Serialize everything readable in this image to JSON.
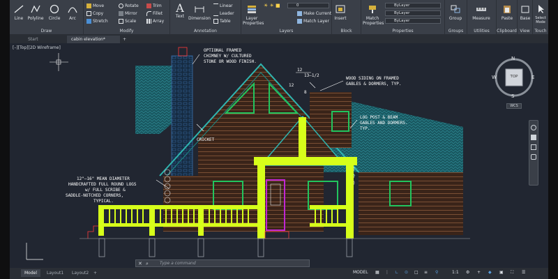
{
  "ribbon": {
    "draw": {
      "label": "Draw",
      "line": "Line",
      "polyline": "Polyline",
      "circle": "Circle",
      "arc": "Arc"
    },
    "modify": {
      "label": "Modify",
      "move": "Move",
      "rotate": "Rotate",
      "trim": "Trim",
      "copy": "Copy",
      "mirror": "Mirror",
      "fillet": "Fillet",
      "stretch": "Stretch",
      "scale": "Scale",
      "array": "Array"
    },
    "annotation": {
      "label": "Annotation",
      "text": "Text",
      "dimension": "Dimension",
      "linear": "Linear",
      "leader": "Leader",
      "table": "Table"
    },
    "layers": {
      "label": "Layers",
      "layer_properties": "Layer Properties",
      "current_layer": "0",
      "make_current": "Make Current",
      "match_layer": "Match Layer"
    },
    "block": {
      "label": "Block",
      "insert": "Insert"
    },
    "properties": {
      "label": "Properties",
      "match_properties": "Match Properties",
      "bylayer": "ByLayer"
    },
    "groups": {
      "label": "Groups",
      "group": "Group"
    },
    "utilities": {
      "label": "Utilities",
      "measure": "Measure"
    },
    "clipboard": {
      "label": "Clipboard",
      "paste": "Paste"
    },
    "view": {
      "label": "View",
      "base": "Base"
    },
    "touch": {
      "label": "Touch",
      "select_mode": "Select Mode"
    }
  },
  "file_tabs": [
    "Start",
    "cabin elevation*"
  ],
  "viewport_label": "[–][Top][2D Wireframe]",
  "viewcube": {
    "n": "N",
    "s": "S",
    "e": "E",
    "w": "W",
    "top": "TOP",
    "wcs": "WCS"
  },
  "annotations": {
    "chimney": [
      "OPTIONAL FRAMED",
      "CHIMNEY W/ CULTURED",
      "STONE OR WOOD FINISH."
    ],
    "siding": [
      "WOOD SIDING ON FRAMED",
      "GABLES & DORMERS, TYP."
    ],
    "log_post": [
      "LOG POST & BEAM",
      "GABLES AND DORMERS.",
      "TYP."
    ],
    "cricket": "CRICKET",
    "logs": [
      "12\"–16\" MEAN DIAMETER",
      "HANDCRAFTED FULL ROUND LOGS",
      "w/ FULL SCRIBE &",
      "SADDLE-NOTCHED CORNERS,",
      "TYPICAL."
    ],
    "pitch_12": "12",
    "pitch_13": "13–1/2",
    "pitch_12b": "12",
    "pitch_8": "8"
  },
  "command_placeholder": "Type a command",
  "layout_tabs": [
    "Model",
    "Layout1",
    "Layout2"
  ],
  "status": {
    "model": "MODEL",
    "scale": "1:1"
  },
  "colors": {
    "accent_green": "#d7ff1a",
    "roof_teal": "#1f7f86",
    "wall": "#5a3a2a",
    "window_green": "#22c55e",
    "door_magenta": "#c026d3"
  }
}
